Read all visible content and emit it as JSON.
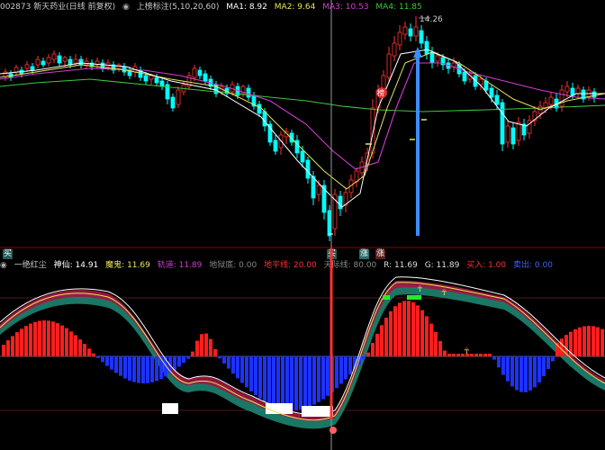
{
  "header": {
    "code_title": "002873 新天药业(日线 前复权)",
    "indicator_name": "上榜标注",
    "params": "(5,10,20,60)",
    "ma1_label": "MA1: 8.92",
    "ma2_label": "MA2: 9.64",
    "ma3_label": "MA3: 10.53",
    "ma4_label": "MA4: 11.85"
  },
  "price_panel": {
    "high_marker": "14.26",
    "bang_tag": "榜",
    "bottom_tags": {
      "buy1": "买",
      "buy2": "买",
      "sell": "涨",
      "up": "涨"
    }
  },
  "indicator_header": {
    "name": "一绝红尘",
    "shenxian": "神仙: 14.91",
    "mogui": "魔鬼: 11.69",
    "guidao": "轨道: 11.89",
    "diyudi": "地狱底: 0.00",
    "dipingxian": "地平线: 20.00",
    "tianjiexian": "天际线: 80.00",
    "r": "R: 11.69",
    "g": "G: 11.89",
    "mairu": "买入: 1.00",
    "maichu": "卖出: 0.00"
  },
  "colors": {
    "ma1": "#ffffff",
    "ma2": "#e6e65a",
    "ma3": "#d23cd2",
    "ma4": "#3cc83c",
    "up": "#ff3232",
    "down": "#00ffff",
    "macd_up": "#ff1e1e",
    "macd_down": "#1e32ff"
  }
}
